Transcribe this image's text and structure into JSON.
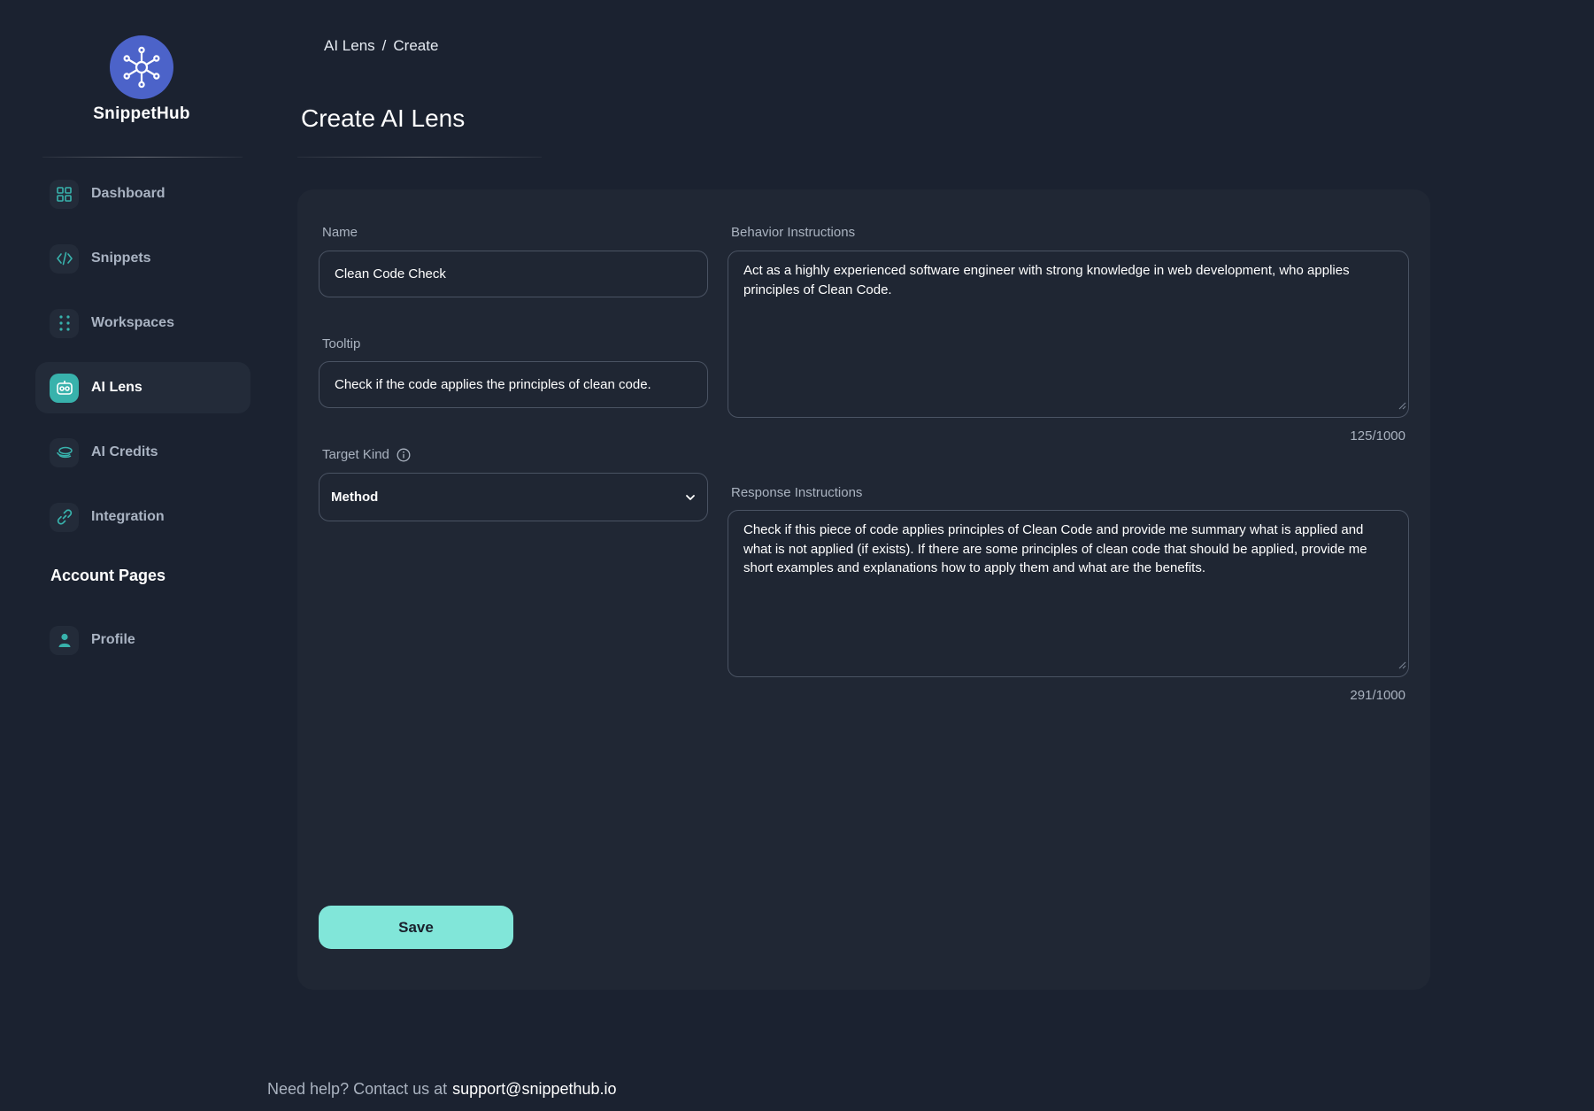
{
  "app": {
    "name": "SnippetHub",
    "logo_icon": "network-hub-icon",
    "accent": "#38b2ac",
    "brand": "#4c63c9"
  },
  "sidebar": {
    "items": [
      {
        "label": "Dashboard",
        "icon": "grid-icon",
        "active": false
      },
      {
        "label": "Snippets",
        "icon": "code-icon",
        "active": false
      },
      {
        "label": "Workspaces",
        "icon": "dots-grid-icon",
        "active": false
      },
      {
        "label": "AI Lens",
        "icon": "robot-icon",
        "active": true
      },
      {
        "label": "AI Credits",
        "icon": "coins-icon",
        "active": false
      },
      {
        "label": "Integration",
        "icon": "link-icon",
        "active": false
      }
    ],
    "account_section_title": "Account Pages",
    "account_items": [
      {
        "label": "Profile",
        "icon": "person-icon"
      }
    ]
  },
  "breadcrumb": {
    "parent": "AI Lens",
    "separator": "/",
    "current": "Create"
  },
  "page_title": "Create AI Lens",
  "form": {
    "name": {
      "label": "Name",
      "value": "Clean Code Check"
    },
    "tooltip": {
      "label": "Tooltip",
      "value": "Check if the code applies the principles of clean code."
    },
    "target_kind": {
      "label": "Target Kind",
      "value": "Method"
    },
    "behavior": {
      "label": "Behavior Instructions",
      "value": "Act as a highly experienced software engineer with strong knowledge in web development, who applies principles of Clean Code.",
      "counter": "125/1000"
    },
    "response": {
      "label": "Response Instructions",
      "value": "Check if this piece of code applies principles of Clean Code and provide me summary what is applied and what is not applied (if exists). If there are some principles of clean code that should be applied, provide me short examples and explanations how to apply them and what are the benefits.",
      "counter": "291/1000"
    },
    "save_label": "Save"
  },
  "footer": {
    "text": "Need help? Contact us at",
    "email": "support@snippethub.io"
  }
}
